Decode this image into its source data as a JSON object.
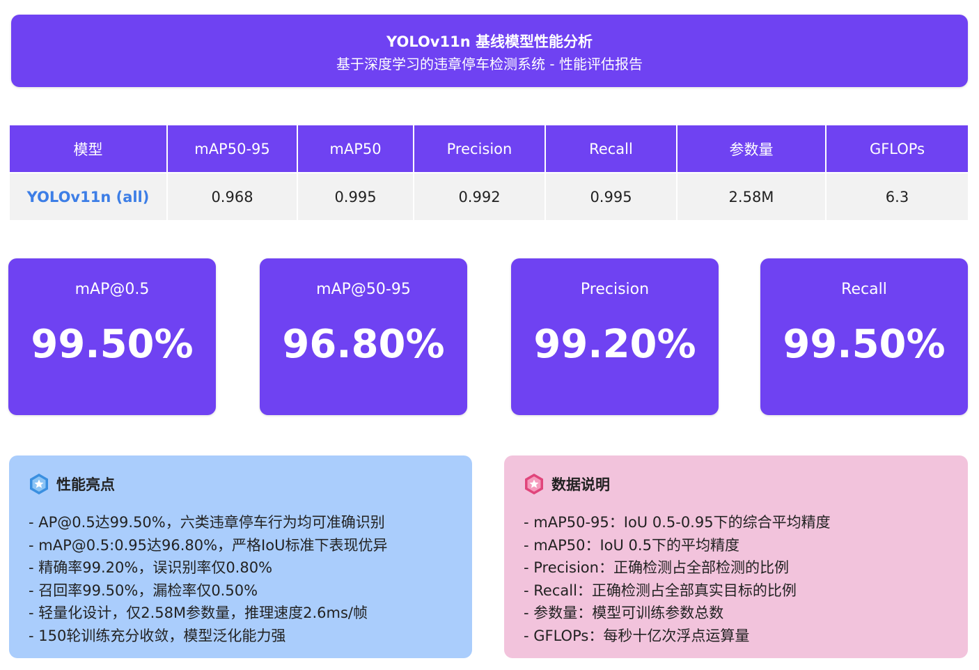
{
  "header": {
    "title": "YOLOv11n 基线模型性能分析",
    "subtitle": "基于深度学习的违章停车检测系统 - 性能评估报告"
  },
  "table": {
    "columns": [
      "模型",
      "mAP50-95",
      "mAP50",
      "Precision",
      "Recall",
      "参数量",
      "GFLOPs"
    ],
    "row": [
      "YOLOv11n (all)",
      "0.968",
      "0.995",
      "0.992",
      "0.995",
      "2.58M",
      "6.3"
    ]
  },
  "cards": [
    {
      "label": "mAP@0.5",
      "value": "99.50%"
    },
    {
      "label": "mAP@50-95",
      "value": "96.80%"
    },
    {
      "label": "Precision",
      "value": "99.20%"
    },
    {
      "label": "Recall",
      "value": "99.50%"
    }
  ],
  "highlights": {
    "title": "性能亮点",
    "icon": "star-badge-icon",
    "color": "#3a8fe0",
    "items": [
      "- AP@0.5达99.50%，六类违章停车行为均可准确识别",
      "- mAP@0.5:0.95达96.80%，严格IoU标准下表现优异",
      "- 精确率99.20%，误识别率仅0.80%",
      "- 召回率99.50%，漏检率仅0.50%",
      "- 轻量化设计，仅2.58M参数量，推理速度2.6ms/帧",
      "- 150轮训练充分收敛，模型泛化能力强"
    ]
  },
  "notes": {
    "title": "数据说明",
    "icon": "star-badge-icon",
    "color": "#e0457b",
    "items": [
      "- mAP50-95：IoU 0.5-0.95下的综合平均精度",
      "- mAP50：IoU 0.5下的平均精度",
      "- Precision：正确检测占全部检测的比例",
      "- Recall：正确检测占全部真实目标的比例",
      "- 参数量：模型可训练参数总数",
      "- GFLOPs：每秒十亿次浮点运算量"
    ]
  },
  "colors": {
    "primary": "#6f42f2",
    "model_text": "#3d7ee6",
    "panel_blue": "#aacdfc",
    "panel_pink": "#f2c3dc"
  }
}
